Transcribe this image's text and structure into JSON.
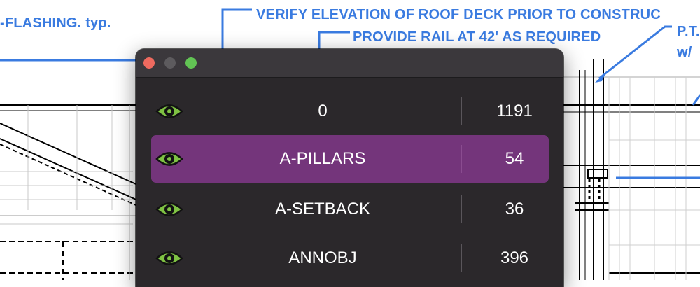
{
  "annotations": [
    "-FLASHING. typ.",
    "VERIFY ELEVATION OF ROOF DECK PRIOR TO CONSTRUC",
    "PROVIDE RAIL AT 42' AS REQUIRED",
    "P.T.",
    "w/"
  ],
  "window": {
    "controls": [
      "close",
      "minimize",
      "zoom"
    ]
  },
  "layers": [
    {
      "name": "0",
      "count": "1191",
      "visible": true,
      "selected": false
    },
    {
      "name": "A-PILLARS",
      "count": "54",
      "visible": true,
      "selected": true
    },
    {
      "name": "A-SETBACK",
      "count": "36",
      "visible": true,
      "selected": false
    },
    {
      "name": "ANNOBJ",
      "count": "396",
      "visible": true,
      "selected": false
    }
  ],
  "colors": {
    "annotation": "#3a7be0",
    "panel_background": "#2b282b",
    "selected_row": "#74357b",
    "eye_icon": "#7fc243"
  }
}
